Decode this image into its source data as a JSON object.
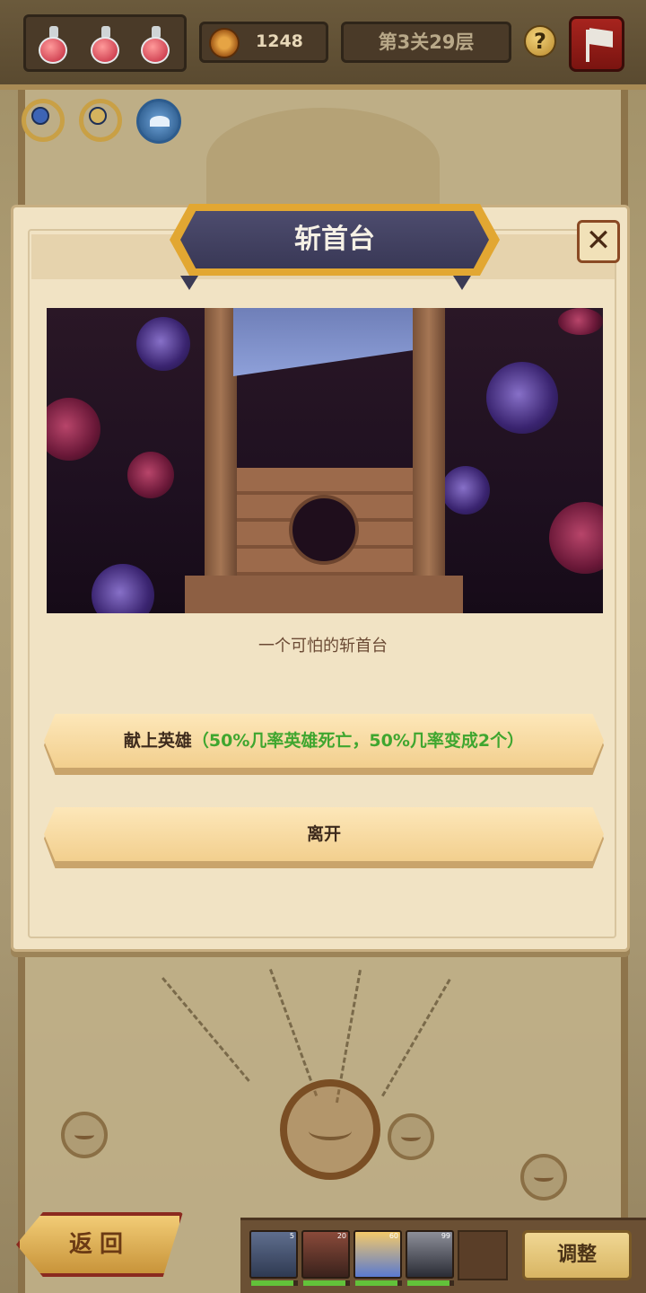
{
  "top_bar": {
    "potions": [
      "potion-icon",
      "potion-icon",
      "potion-icon"
    ],
    "coins": "1248",
    "level": "第3关29层",
    "help_label": "?"
  },
  "dialog": {
    "title": "斩首台",
    "close_label": "✕",
    "description": "一个可怕的斩首台",
    "options": [
      {
        "label": "献上英雄",
        "detail": "（50%几率英雄死亡，50%几率变成2个）"
      },
      {
        "label": "离开",
        "detail": ""
      }
    ]
  },
  "bottom_bar": {
    "back_label": "返回",
    "adjust_label": "调整",
    "heroes": [
      {
        "level": "5",
        "hp": 0.9
      },
      {
        "level": "20",
        "hp": 0.9
      },
      {
        "level": "60",
        "hp": 0.9
      },
      {
        "level": "99",
        "hp": 0.9
      }
    ]
  },
  "colors": {
    "accent_green": "#3fa62f",
    "title_plate": "#393856",
    "gold": "#e2a732"
  }
}
